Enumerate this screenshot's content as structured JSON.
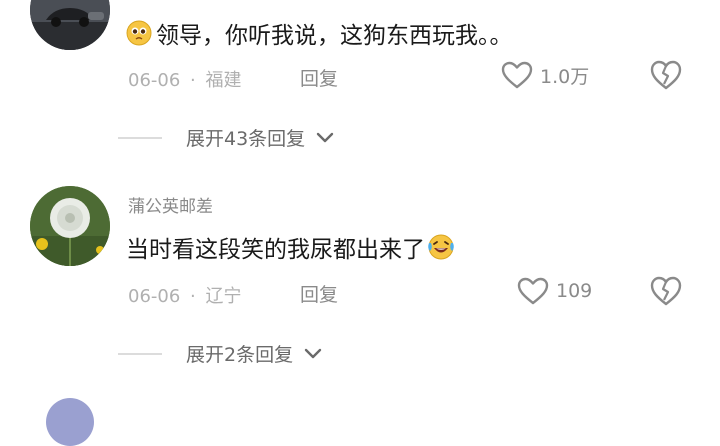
{
  "comments": [
    {
      "username": "",
      "text": "领导，你听我说，这狗东西玩我。。",
      "date": "06-06",
      "location": "福建",
      "reply_label": "回复",
      "likes": "1.0万",
      "emoji": "pleading-face",
      "expand_label": "展开43条回复"
    },
    {
      "username": "蒲公英邮差",
      "text": "当时看这段笑的我尿都出来了",
      "date": "06-06",
      "location": "辽宁",
      "reply_label": "回复",
      "likes": "109",
      "emoji": "laughing-crying-face",
      "expand_label": "展开2条回复"
    }
  ],
  "separator": "·",
  "colors": {
    "text": "#1a1a1a",
    "muted": "#8a8a8a",
    "meta": "#b0b0b0",
    "divider": "#dcdcdc"
  }
}
